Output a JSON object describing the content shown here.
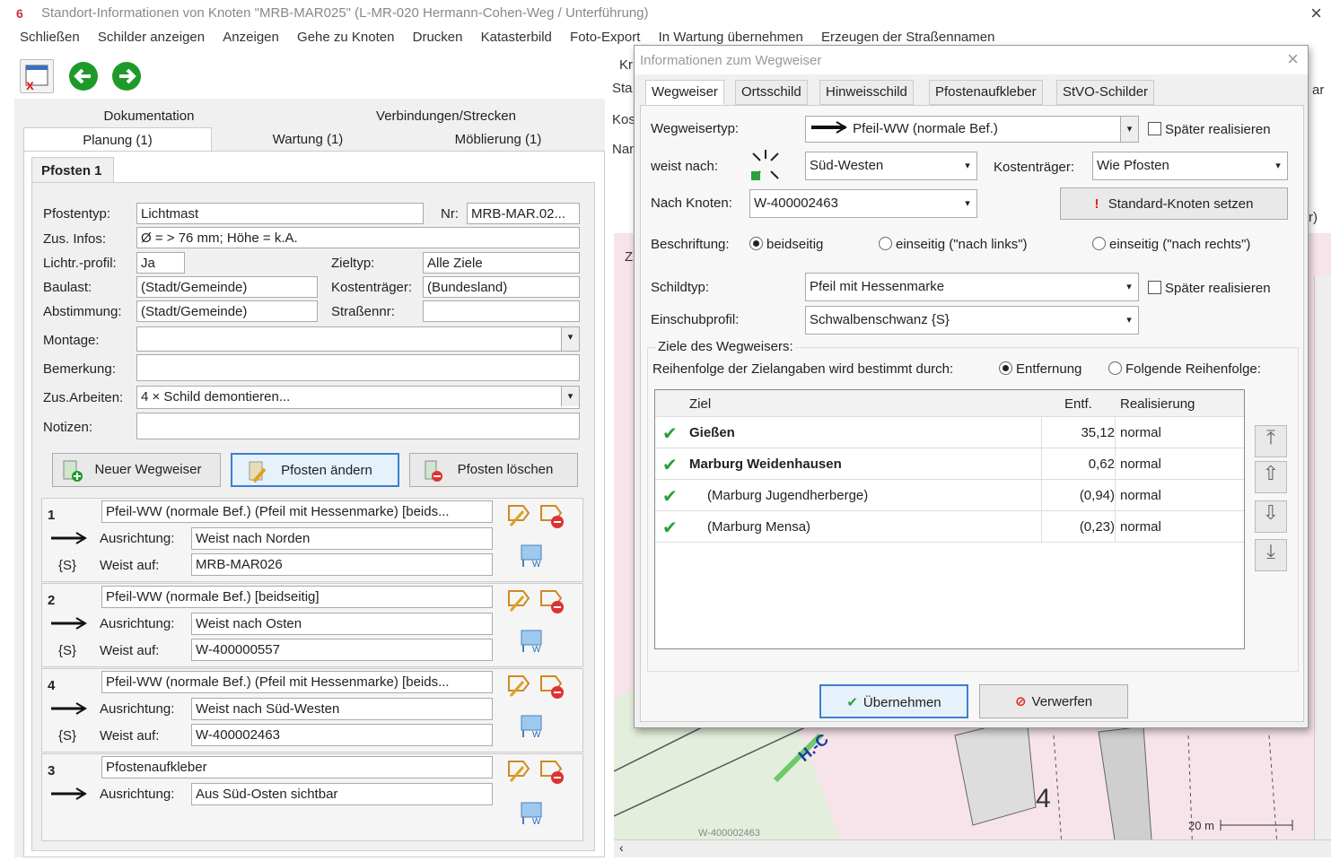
{
  "window": {
    "title": "Standort-Informationen von Knoten \"MRB-MAR025\" (L-MR-020 Hermann-Cohen-Weg / Unterführung)",
    "close": "×"
  },
  "menu": [
    "Schließen",
    "Schilder anzeigen",
    "Anzeigen",
    "Gehe zu Knoten",
    "Drucken",
    "Katasterbild",
    "Foto-Export",
    "In Wartung übernehmen",
    "Erzeugen der Straßennamen"
  ],
  "tabs_top": [
    "Dokumentation",
    "Verbindungen/Strecken"
  ],
  "tabs_bottom": [
    "Planung (1)",
    "Wartung (1)",
    "Möblierung (1)"
  ],
  "post_tab": "Pfosten 1",
  "form": {
    "pfostentyp_label": "Pfostentyp:",
    "pfostentyp": "Lichtmast",
    "nr_label": "Nr:",
    "nr": "MRB-MAR.02...",
    "zusinfos_label": "Zus. Infos:",
    "zusinfos": "Ø = > 76 mm; Höhe = k.A.",
    "lichtprofil_label": "Lichtr.-profil:",
    "lichtprofil": "Ja",
    "zieltyp_label": "Zieltyp:",
    "zieltyp": "Alle Ziele",
    "baulast_label": "Baulast:",
    "baulast": "(Stadt/Gemeinde)",
    "kostentraeger_label": "Kostenträger:",
    "kostentraeger": "(Bundesland)",
    "abstimmung_label": "Abstimmung:",
    "abstimmung": "(Stadt/Gemeinde)",
    "strassennr_label": "Straßennr:",
    "strassennr": "",
    "montage_label": "Montage:",
    "montage": "",
    "bemerkung_label": "Bemerkung:",
    "bemerkung": "",
    "zusarbeiten_label": "Zus.Arbeiten:",
    "zusarbeiten": "4 × Schild demontieren...",
    "notizen_label": "Notizen:",
    "notizen": ""
  },
  "buttons": {
    "neuer": "Neuer Wegweiser",
    "aendern": "Pfosten ändern",
    "loeschen": "Pfosten löschen"
  },
  "signs": [
    {
      "num": "1",
      "desc": "Pfeil-WW (normale Bef.) (Pfeil mit Hessenmarke) [beids...",
      "ausrichtung": "Weist nach Norden",
      "weist": "MRB-MAR026",
      "code": "{S}"
    },
    {
      "num": "2",
      "desc": "Pfeil-WW (normale Bef.) [beidseitig]",
      "ausrichtung": "Weist nach Osten",
      "weist": "W-400000557",
      "code": "{S}"
    },
    {
      "num": "4",
      "desc": "Pfeil-WW (normale Bef.) (Pfeil mit Hessenmarke) [beids...",
      "ausrichtung": "Weist nach Süd-Westen",
      "weist": "W-400002463",
      "code": "{S}"
    },
    {
      "num": "3",
      "desc": "Pfostenaufkleber",
      "ausrichtung": "Aus Süd-Osten sichtbar",
      "weist": "",
      "code": ""
    }
  ],
  "sign_labels": {
    "ausrichtung": "Ausrichtung:",
    "weist": "Weist auf:"
  },
  "behind": {
    "kr": "Kr",
    "sta": "Sta",
    "kos": "Kos",
    "nam": "Nam",
    "z": "Z",
    "a": "A",
    "ar": "ar",
    "r": "r)",
    "map_label": "H.-C",
    "scale": "20 m",
    "node": "W-400002463"
  },
  "dialog": {
    "title": "Informationen zum Wegweiser",
    "close": "×",
    "tabs": [
      "Wegweiser",
      "Ortsschild",
      "Hinweisschild",
      "Pfostenaufkleber",
      "StVO-Schilder"
    ],
    "wegweisertyp_label": "Wegweisertyp:",
    "wegweisertyp": "Pfeil-WW (normale Bef.)",
    "spaeter": "Später realisieren",
    "weist_label": "weist nach:",
    "weist": "Süd-Westen",
    "kostentraeger_label": "Kostenträger:",
    "kostentraeger": "Wie Pfosten",
    "nachknoten_label": "Nach Knoten:",
    "nachknoten": "W-400002463",
    "standard_btn": "Standard-Knoten setzen",
    "beschriftung_label": "Beschriftung:",
    "r1": "beidseitig",
    "r2": "einseitig (\"nach links\")",
    "r3": "einseitig (\"nach rechts\")",
    "schildtyp_label": "Schildtyp:",
    "schildtyp": "Pfeil mit Hessenmarke",
    "einschub_label": "Einschubprofil:",
    "einschub": "Schwalbenschwanz {S}",
    "ziele_group": "Ziele des Wegweisers:",
    "reihenfolge_label": "Reihenfolge der Zielangaben wird bestimmt durch:",
    "rf1": "Entfernung",
    "rf2": "Folgende Reihenfolge:",
    "columns": [
      "Ziel",
      "Entf.",
      "Realisierung"
    ],
    "rows": [
      {
        "ziel": "Gießen",
        "entf": "35,12",
        "real": "normal",
        "bold": true
      },
      {
        "ziel": "Marburg Weidenhausen",
        "entf": "0,62",
        "real": "normal",
        "bold": true
      },
      {
        "ziel": "(Marburg Jugendherberge)",
        "entf": "(0,94)",
        "real": "normal",
        "bold": false
      },
      {
        "ziel": "(Marburg Mensa)",
        "entf": "(0,23)",
        "real": "normal",
        "bold": false
      }
    ],
    "ok": "Übernehmen",
    "cancel": "Verwerfen"
  },
  "colors": {
    "accent": "#3c7fd0",
    "check": "#1f9a2a",
    "nav_green": "#1e9a2a"
  }
}
